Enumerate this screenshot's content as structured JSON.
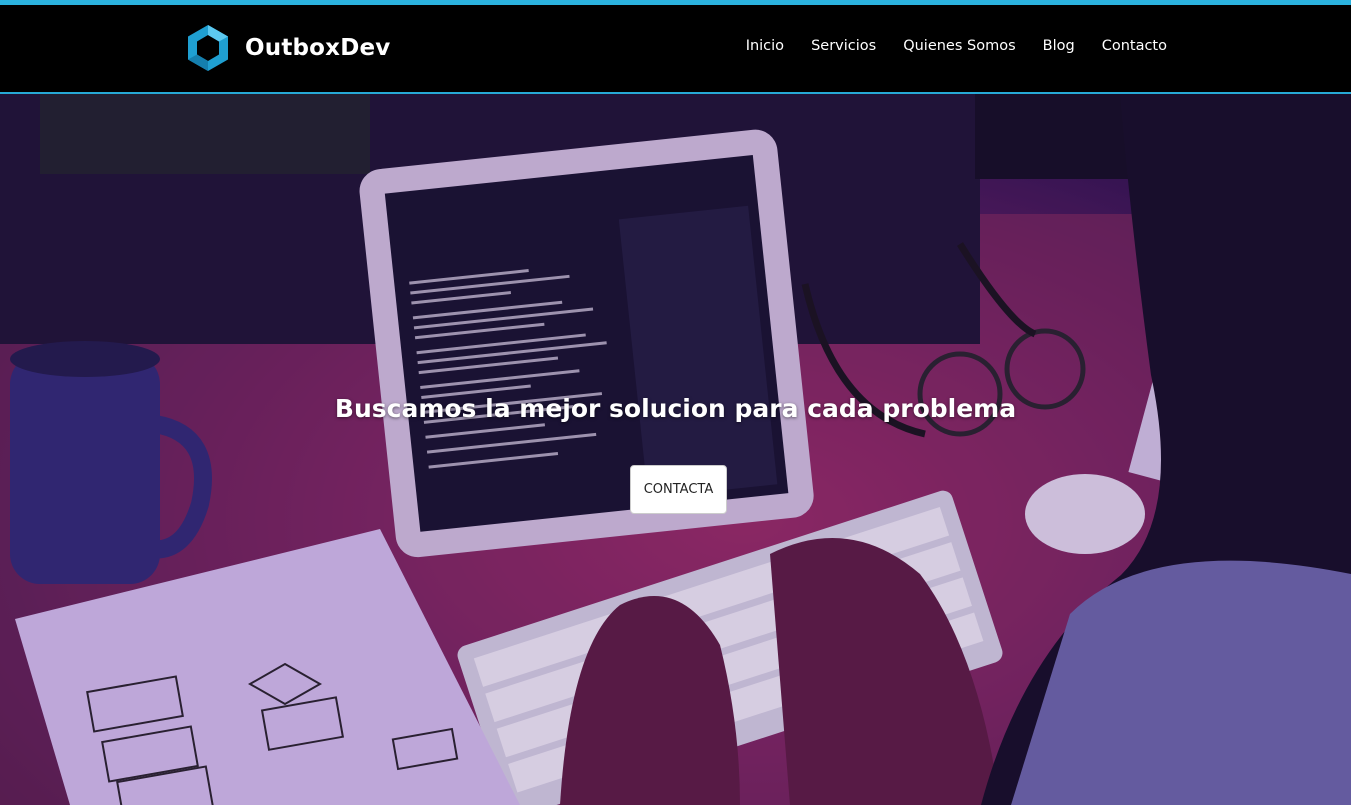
{
  "brand": {
    "name": "OutboxDev",
    "logo_icon": "hexagon-logo-icon",
    "accent_color": "#2bb3df"
  },
  "nav": {
    "items": [
      {
        "label": "Inicio"
      },
      {
        "label": "Servicios"
      },
      {
        "label": "Quienes Somos"
      },
      {
        "label": "Blog"
      },
      {
        "label": "Contacto"
      }
    ]
  },
  "hero": {
    "headline": "Buscamos la mejor solucion para cada problema",
    "cta_label": "CONTACTA"
  }
}
